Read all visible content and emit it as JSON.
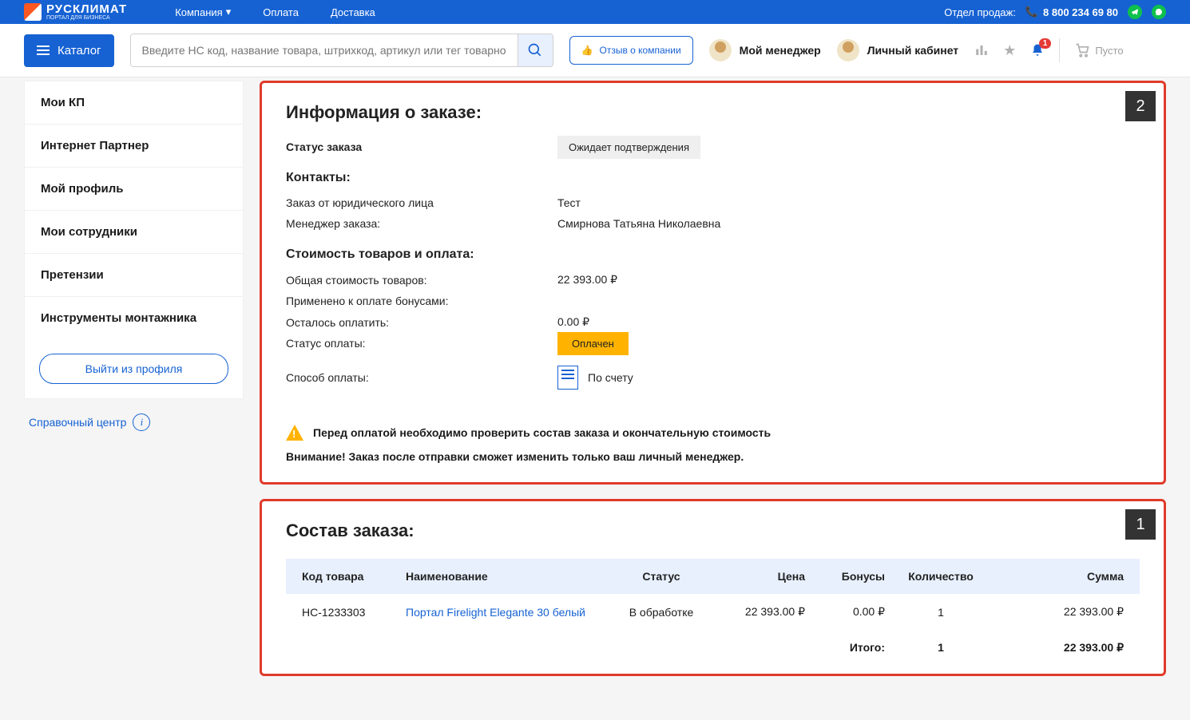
{
  "topbar": {
    "brand_name": "РУСКЛИМАТ",
    "brand_sub": "ПОРТАЛ ДЛЯ БИЗНЕСА",
    "nav": {
      "company": "Компания",
      "payment": "Оплата",
      "delivery": "Доставка"
    },
    "sales_label": "Отдел продаж:",
    "phone": "8 800 234 69 80"
  },
  "toolbar": {
    "catalog": "Каталог",
    "search_placeholder": "Введите НС код, название товара, штрихкод, артикул или тег товарной группы",
    "review": "Отзыв о компании",
    "manager": "Мой менеджер",
    "cabinet": "Личный кабинет",
    "notifications_count": "1",
    "cart_label": "Пусто"
  },
  "sidebar": {
    "items": [
      "Мои КП",
      "Интернет Партнер",
      "Мой профиль",
      "Мои сотрудники",
      "Претензии",
      "Инструменты монтажника"
    ],
    "logout": "Выйти из профиля",
    "help": "Справочный центр"
  },
  "order_info": {
    "panel_num": "2",
    "title": "Информация о заказе:",
    "status_label": "Статус заказа",
    "status_value": "Ожидает подтверждения",
    "contacts_h": "Контакты:",
    "from_label": "Заказ от юридического лица",
    "from_value": "Тест",
    "manager_label": "Менеджер заказа:",
    "manager_value": "Смирнова Татьяна Николаевна",
    "cost_h": "Стоимость товаров и оплата:",
    "total_label": "Общая стоимость товаров:",
    "total_value": "22 393.00 ₽",
    "bonus_label": "Применено к оплате бонусами:",
    "remaining_label": "Осталось оплатить:",
    "remaining_value": "0.00 ₽",
    "paystatus_label": "Статус оплаты:",
    "paystatus_value": "Оплачен",
    "paymethod_label": "Способ оплаты:",
    "paymethod_value": "По счету",
    "warning": "Перед оплатой необходимо проверить состав заказа и окончательную стоимость",
    "attention": "Внимание! Заказ после отправки сможет изменить только ваш личный менеджер."
  },
  "order_items": {
    "panel_num": "1",
    "title": "Состав заказа:",
    "headers": {
      "code": "Код товара",
      "name": "Наименование",
      "status": "Статус",
      "price": "Цена",
      "bonus": "Бонусы",
      "qty": "Количество",
      "sum": "Сумма"
    },
    "rows": [
      {
        "code": "НС-1233303",
        "name": "Портал Firelight Elegante 30 белый",
        "status": "В обработке",
        "price": "22 393.00 ₽",
        "bonus": "0.00 ₽",
        "qty": "1",
        "sum": "22 393.00 ₽"
      }
    ],
    "footer": {
      "label": "Итого:",
      "qty": "1",
      "sum": "22 393.00 ₽"
    }
  }
}
